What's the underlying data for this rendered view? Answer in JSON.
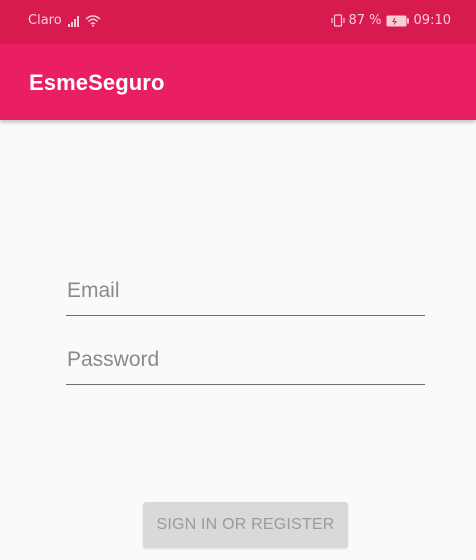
{
  "status_bar": {
    "carrier": "Claro",
    "battery_percent": "87 %",
    "time": "09:10"
  },
  "app_bar": {
    "title": "EsmeSeguro",
    "background_color": "#e91e63"
  },
  "form": {
    "email": {
      "placeholder": "Email",
      "value": ""
    },
    "password": {
      "placeholder": "Password",
      "value": ""
    },
    "submit_label": "SIGN IN OR REGISTER"
  },
  "icons": [
    "signal-icon",
    "wifi-icon",
    "vibrate-icon",
    "battery-icon"
  ]
}
